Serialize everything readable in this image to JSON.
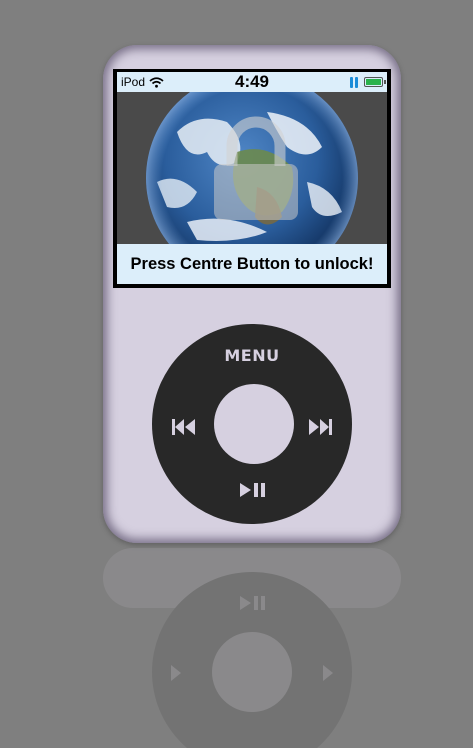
{
  "status_bar": {
    "device_name": "iPod",
    "wifi_icon": "wifi-icon",
    "time": "4:49",
    "playback_icon": "pause-icon",
    "battery_icon": "battery-icon",
    "battery_level": 1.0
  },
  "lock_screen": {
    "wallpaper": "earth-globe",
    "lock_icon": "padlock-icon",
    "message": "Press Centre Button to unlock!"
  },
  "click_wheel": {
    "menu_label": "MENU",
    "prev_icon": "rewind-icon",
    "next_icon": "fast-forward-icon",
    "play_pause_icon": "play-pause-icon"
  },
  "colors": {
    "body": "#d6d0e0",
    "wheel": "#282828",
    "screen_bar": "#dceefa",
    "background": "#7f7f7f",
    "battery_fill": "#2bb24c",
    "pause_accent": "#1a8cd8"
  }
}
